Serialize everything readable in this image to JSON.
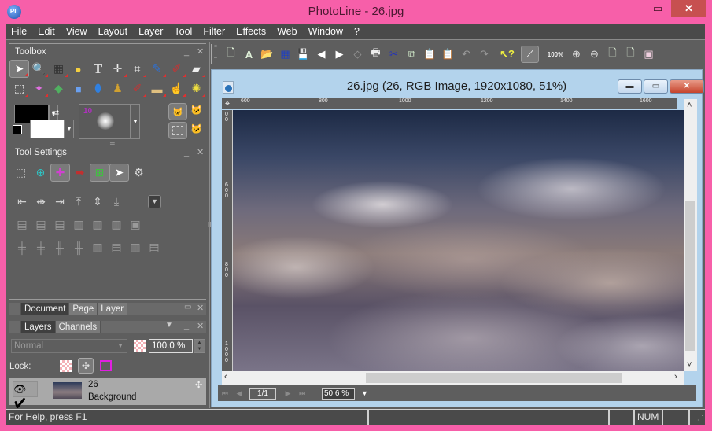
{
  "window": {
    "title": "PhotoLine - 26.jpg",
    "app_icon": "PL",
    "controls": {
      "minimize": "–",
      "maximize": "▭",
      "close": "✕"
    }
  },
  "menu": [
    "File",
    "Edit",
    "View",
    "Layout",
    "Layer",
    "Tool",
    "Filter",
    "Effects",
    "Web",
    "Window",
    "?"
  ],
  "toolbox": {
    "title": "Toolbox",
    "tools_row1": [
      "pointer",
      "magnifier",
      "warp",
      "ellipse",
      "text",
      "path",
      "crop",
      "eyedropper",
      "brush",
      "eraser"
    ],
    "tools_row2": [
      "rect-select",
      "magic-wand",
      "fill",
      "gradient",
      "bucket",
      "stamp",
      "clone-brush",
      "healing-brush",
      "smudge",
      "dodge"
    ],
    "selected_tool": "pointer",
    "brush_size": "10",
    "foreground_color": "#000000",
    "background_color": "#ffffff"
  },
  "tool_settings": {
    "title": "Tool Settings"
  },
  "panels": {
    "tabs_top": [
      "Document",
      "Page",
      "Layer"
    ],
    "tabs_layers": [
      "Layers",
      "Channels"
    ],
    "blend_mode": "Normal",
    "opacity": "100.0 %",
    "lock_label": "Lock:",
    "layer": {
      "name": "26",
      "type": "Background"
    }
  },
  "toolbar": {
    "zoom_label": "100%"
  },
  "document": {
    "title": "26.jpg (26, RGB Image, 1920x1080, 51%)",
    "hruler": [
      "600",
      "800",
      "1000",
      "1200",
      "1400",
      "1600"
    ],
    "vruler": [
      "0\n0",
      "6\n0\n0",
      "8\n0\n0",
      "1\n0\n0\n0"
    ],
    "page": "1/1",
    "zoom": "50.6 %"
  },
  "status": {
    "help": "For Help, press F1",
    "num": "NUM"
  }
}
